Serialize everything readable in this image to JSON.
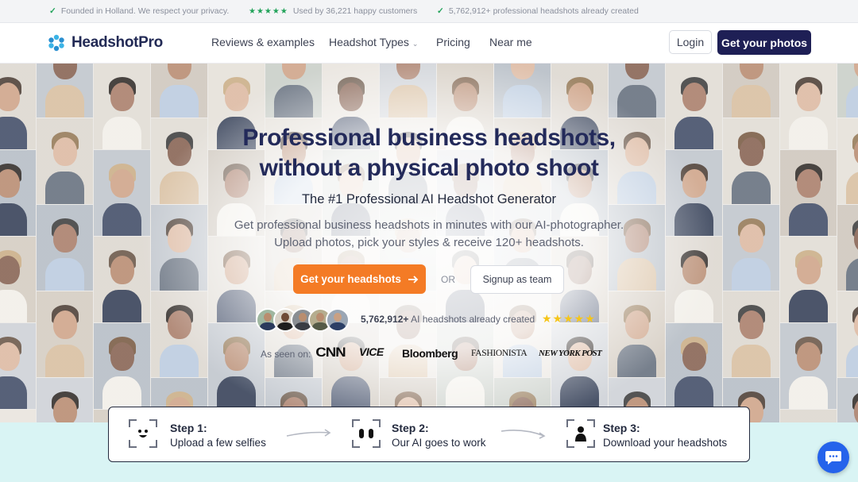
{
  "topbar": {
    "item1": "Founded in Holland. We respect your privacy.",
    "item2_stars": "★★★★★",
    "item2": "Used by 36,221 happy customers",
    "item3": "5,762,912+ professional headshots already created"
  },
  "nav": {
    "brand": "HeadshotPro",
    "links": [
      "Reviews & examples",
      "Headshot Types",
      "Pricing",
      "Near me"
    ],
    "login": "Login",
    "cta": "Get your photos"
  },
  "hero": {
    "title_line1": "Professional business headshots,",
    "title_line2": "without a physical photo shoot",
    "subtitle": "The #1 Professional AI Headshot Generator",
    "description": "Get professional business headshots in minutes with our AI-photographer. Upload photos, pick your styles & receive 120+ headshots.",
    "cta": "Get your headshots",
    "or": "OR",
    "team": "Signup as team",
    "count_bold": "5,762,912+",
    "count_text": " AI headshots already created",
    "stars": "★★★★★",
    "seen_on": "As seen on:",
    "press": [
      "CNN",
      "VICE",
      "Bloomberg",
      "FASHIONISTA",
      "NEW YORK POST"
    ]
  },
  "steps": [
    {
      "title": "Step 1:",
      "text": "Upload a few selfies"
    },
    {
      "title": "Step 2:",
      "text": "Our AI goes to work"
    },
    {
      "title": "Step 3:",
      "text": "Download your headshots"
    }
  ],
  "colors": {
    "brand_navy": "#1e1f55",
    "accent_orange": "#f47b25",
    "check_green": "#22a35a",
    "star_yellow": "#f5c518",
    "band_mint": "#d9f4f4",
    "chat_blue": "#2563eb"
  },
  "icons": {
    "check": "check-icon",
    "chevron": "chevron-down-icon",
    "arrow": "arrow-right-icon",
    "chat": "chat-bubble-icon"
  }
}
